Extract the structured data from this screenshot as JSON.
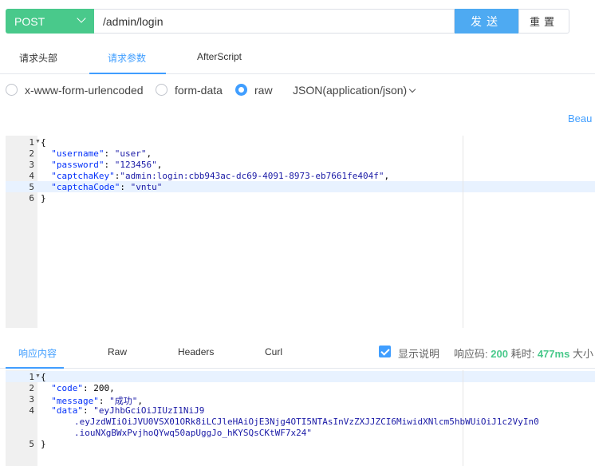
{
  "request": {
    "method": "POST",
    "url": "/admin/login",
    "send_label": "发送",
    "reset_label": "重置"
  },
  "request_tabs": [
    "请求头部",
    "请求参数",
    "AfterScript"
  ],
  "request_tab_active": 1,
  "body_types": {
    "options": [
      "x-www-form-urlencoded",
      "form-data",
      "raw"
    ],
    "selected": "raw",
    "content_type": "JSON(application/json)"
  },
  "beautify_label": "Beau",
  "request_body": {
    "line_numbers": [
      "1",
      "2",
      "3",
      "4",
      "5",
      "6"
    ],
    "lines": {
      "l1": "{",
      "username_key": "\"username\"",
      "username_val": "\"user\"",
      "password_key": "\"password\"",
      "password_val": "\"123456\"",
      "captchakey_key": "\"captchaKey\"",
      "captchakey_val": "\"admin:login:cbb943ac-dc69-4091-8973-eb7661fe404f\"",
      "captchacode_key": "\"captchaCode\"",
      "captchacode_val": "\"vntu\"",
      "l6": "}"
    }
  },
  "response_tabs": [
    "响应内容",
    "Raw",
    "Headers",
    "Curl"
  ],
  "response_tab_active": 0,
  "response_meta": {
    "show_desc_label": "显示说明",
    "show_desc_checked": true,
    "status_label": "响应码:",
    "status_code": "200",
    "time_label": "耗时:",
    "time_value": "477ms",
    "size_label": "大小"
  },
  "response_body": {
    "line_numbers": [
      "1",
      "2",
      "3",
      "4",
      "",
      "",
      "5"
    ],
    "lines": {
      "l1": "{",
      "code_key": "\"code\"",
      "code_val": "200",
      "message_key": "\"message\"",
      "message_val": "\"成功\"",
      "data_key": "\"data\"",
      "data_val_1": "\"eyJhbGciOiJIUzI1NiJ9",
      "data_val_2": ".eyJzdWIiOiJVU0VSX01ORk8iLCJleHAiOjE3Njg4OTI5NTAsInVzZXJJZCI6MiwidXNlcm5hbWUiOiJ1c2VyIn0",
      "data_val_3": ".iouNXgBWxPvjhoQYwq50apUggJo_hKYSQsCKtWF7x24\"",
      "l5": "}"
    }
  },
  "colors": {
    "method_bg": "#49c98b",
    "send_bg": "#4eaaf2",
    "accent": "#409eff",
    "string": "#1a1aa6",
    "key": "#0431fa"
  }
}
